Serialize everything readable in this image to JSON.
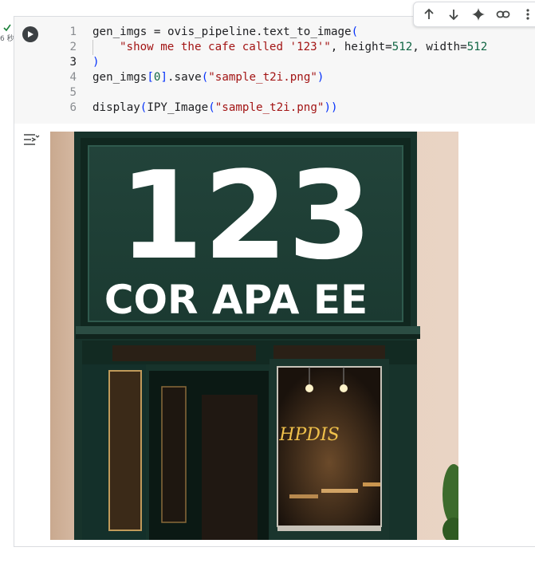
{
  "cell": {
    "exec_time": "6 秒",
    "code_lines": [
      {
        "num": "1"
      },
      {
        "num": "2"
      },
      {
        "num": "3"
      },
      {
        "num": "4"
      },
      {
        "num": "5"
      },
      {
        "num": "6"
      }
    ],
    "tokens": {
      "l1_a": "gen_imgs = ovis_pipeline.text_to_image",
      "l1_paren": "(",
      "l2_str": "\"show me the cafe called '123'\"",
      "l2_a": ", height=",
      "l2_num1": "512",
      "l2_b": ", width=",
      "l2_num2": "512",
      "l3_paren": ")",
      "l4_a": "gen_imgs",
      "l4_lb": "[",
      "l4_num": "0",
      "l4_rb": "]",
      "l4_b": ".save",
      "l4_lp": "(",
      "l4_str": "\"sample_t2i.png\"",
      "l4_rp": ")",
      "l6_a": "display",
      "l6_lp1": "(",
      "l6_b": "IPY_Image",
      "l6_lp2": "(",
      "l6_str": "\"sample_t2i.png\"",
      "l6_rp": "))"
    }
  },
  "toolbar": {
    "icons": [
      "arrow-up-icon",
      "arrow-down-icon",
      "sparkle-icon",
      "link-icon",
      "more-icon"
    ]
  },
  "output": {
    "sign_number": "123",
    "sign_subtitle": "COR APA EE",
    "window_lettering": "HPDIS"
  },
  "colors": {
    "sign_green": "#1f3d34",
    "wall": "#e7cfbe",
    "string": "#a31515",
    "number": "#116644",
    "bracket": "#0431fa"
  }
}
